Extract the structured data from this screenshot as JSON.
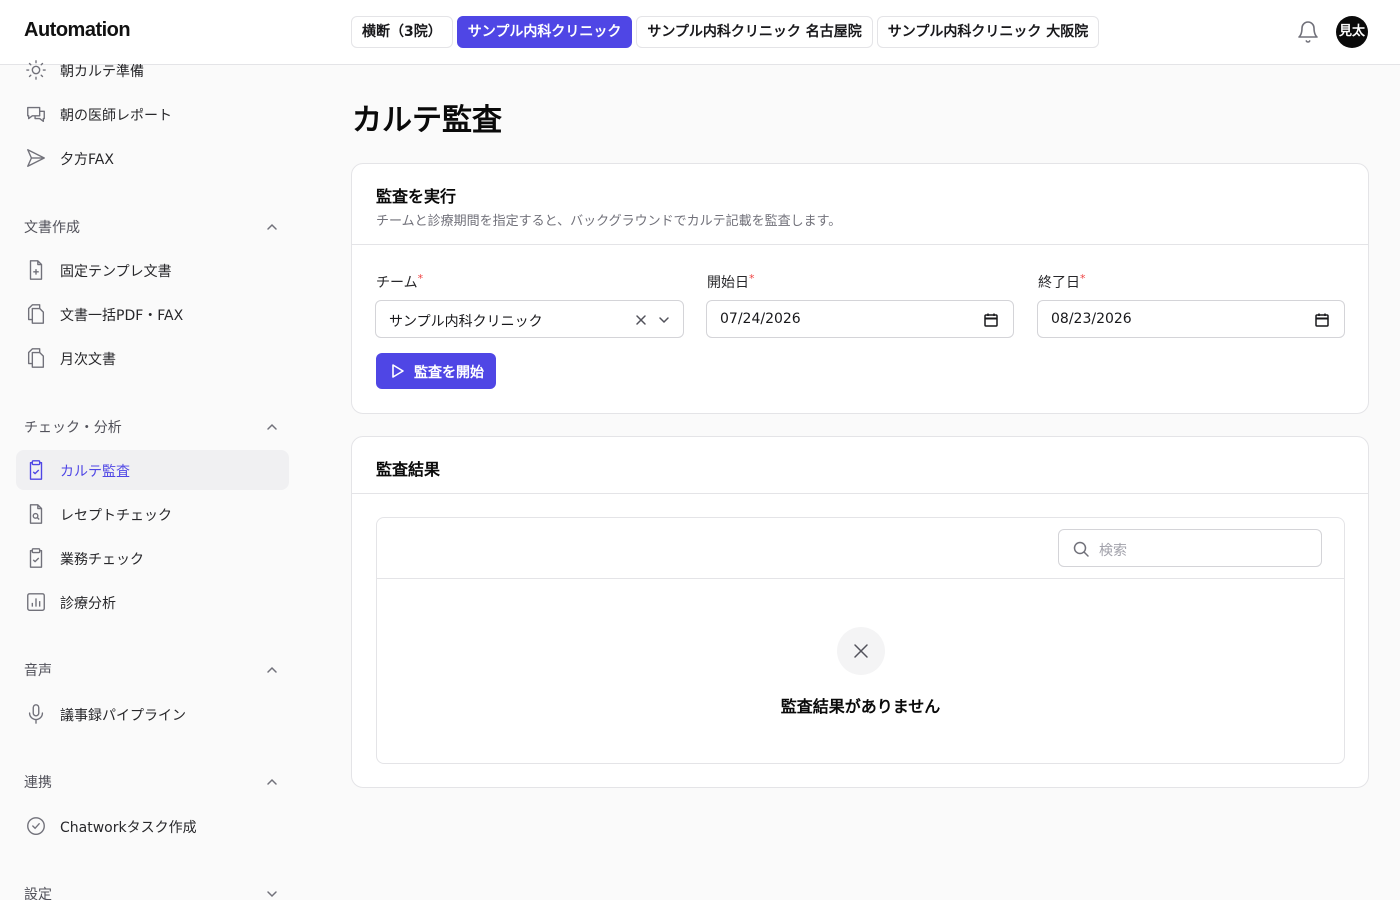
{
  "app": {
    "title": "Automation"
  },
  "header": {
    "teams": [
      {
        "label": "横断（3院）",
        "active": false
      },
      {
        "label": "サンプル内科クリニック",
        "active": true
      },
      {
        "label": "サンプル内科クリニック 名古屋院",
        "active": false
      },
      {
        "label": "サンプル内科クリニック 大阪院",
        "active": false
      }
    ],
    "avatar": "見太"
  },
  "sidebar": {
    "top_items": [
      {
        "label": "朝カルテ準備",
        "icon": "sun-icon"
      },
      {
        "label": "朝の医師レポート",
        "icon": "chat-icon"
      },
      {
        "label": "夕方FAX",
        "icon": "send-icon"
      }
    ],
    "sections": [
      {
        "label": "文書作成",
        "expanded": true,
        "items": [
          {
            "label": "固定テンプレ文書",
            "icon": "file-plus-icon"
          },
          {
            "label": "文書一括PDF・FAX",
            "icon": "files-icon"
          },
          {
            "label": "月次文書",
            "icon": "files-icon"
          }
        ]
      },
      {
        "label": "チェック・分析",
        "expanded": true,
        "items": [
          {
            "label": "カルテ監査",
            "icon": "clipboard-check-icon",
            "active": true
          },
          {
            "label": "レセプトチェック",
            "icon": "file-search-icon"
          },
          {
            "label": "業務チェック",
            "icon": "clipboard-check-icon"
          },
          {
            "label": "診療分析",
            "icon": "bar-chart-icon"
          }
        ]
      },
      {
        "label": "音声",
        "expanded": true,
        "items": [
          {
            "label": "議事録パイプライン",
            "icon": "mic-icon"
          }
        ]
      },
      {
        "label": "連携",
        "expanded": true,
        "items": [
          {
            "label": "Chatworkタスク作成",
            "icon": "check-circle-icon"
          }
        ]
      },
      {
        "label": "設定",
        "expanded": false,
        "items": []
      }
    ]
  },
  "main": {
    "title": "カルテ監査",
    "run_card": {
      "title": "監査を実行",
      "description": "チームと診療期間を指定すると、バックグラウンドでカルテ記載を監査します。",
      "fields": {
        "team": {
          "label": "チーム",
          "value": "サンプル内科クリニック",
          "required": "*"
        },
        "start": {
          "label": "開始日",
          "value": "07/24/2026",
          "required": "*"
        },
        "end": {
          "label": "終了日",
          "value": "08/23/2026",
          "required": "*"
        }
      },
      "start_button": "監査を開始"
    },
    "results_card": {
      "title": "監査結果",
      "search_placeholder": "検索",
      "empty_text": "監査結果がありません"
    }
  },
  "colors": {
    "accent": "#4f46e5",
    "required": "#ef4444"
  }
}
